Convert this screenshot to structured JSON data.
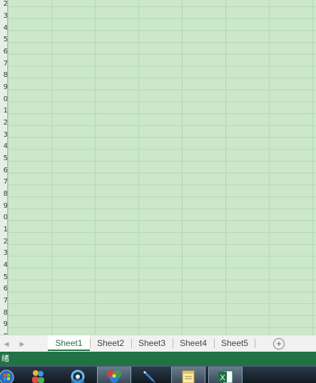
{
  "grid": {
    "row_numbers": [
      "2",
      "3",
      "4",
      "5",
      "6",
      "7",
      "8",
      "9",
      "0",
      "1",
      "2",
      "3",
      "4",
      "5",
      "6",
      "7",
      "8",
      "9",
      "0",
      "1",
      "2",
      "3",
      "4",
      "5",
      "6",
      "7",
      "8",
      "9",
      "0",
      "1",
      "2"
    ]
  },
  "sheet_tabs": {
    "prev_arrow": "◀",
    "next_arrow": "▶",
    "tabs": [
      {
        "label": "Sheet1",
        "active": true
      },
      {
        "label": "Sheet2",
        "active": false
      },
      {
        "label": "Sheet3",
        "active": false
      },
      {
        "label": "Sheet4",
        "active": false
      },
      {
        "label": "Sheet5",
        "active": false
      }
    ],
    "add_label": "+"
  },
  "status_bar": {
    "text": "绪",
    "color": "#217346"
  },
  "taskbar": {
    "apps": [
      {
        "icon": "windows-start-icon"
      },
      {
        "icon": "users-icon"
      },
      {
        "icon": "network-gear-icon"
      },
      {
        "icon": "color-wheel-icon"
      },
      {
        "icon": "pen-icon"
      },
      {
        "icon": "notepad-icon"
      },
      {
        "icon": "excel-icon",
        "label": "X"
      }
    ]
  }
}
